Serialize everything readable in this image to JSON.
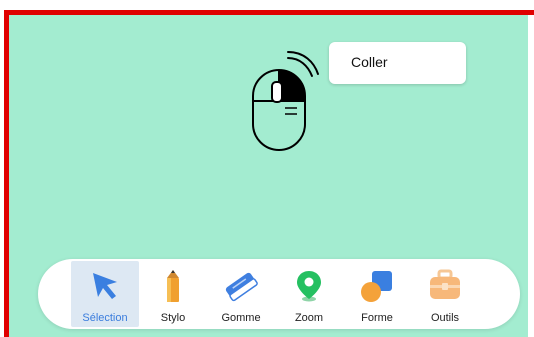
{
  "context_menu": {
    "items": [
      {
        "label": "Coller"
      }
    ]
  },
  "toolbar": {
    "tools": [
      {
        "label": "Sélection",
        "icon": "arrow-cursor-icon",
        "active": true
      },
      {
        "label": "Stylo",
        "icon": "pen-icon",
        "active": false
      },
      {
        "label": "Gomme",
        "icon": "eraser-icon",
        "active": false
      },
      {
        "label": "Zoom",
        "icon": "map-pin-icon",
        "active": false
      },
      {
        "label": "Forme",
        "icon": "shapes-icon",
        "active": false
      },
      {
        "label": "Outils",
        "icon": "toolbox-icon",
        "active": false
      }
    ]
  },
  "colors": {
    "canvas_bg": "#a3ecd0",
    "border": "#e00000",
    "active_tool_bg": "#dde8f3",
    "active_label": "#3b7ddd"
  }
}
